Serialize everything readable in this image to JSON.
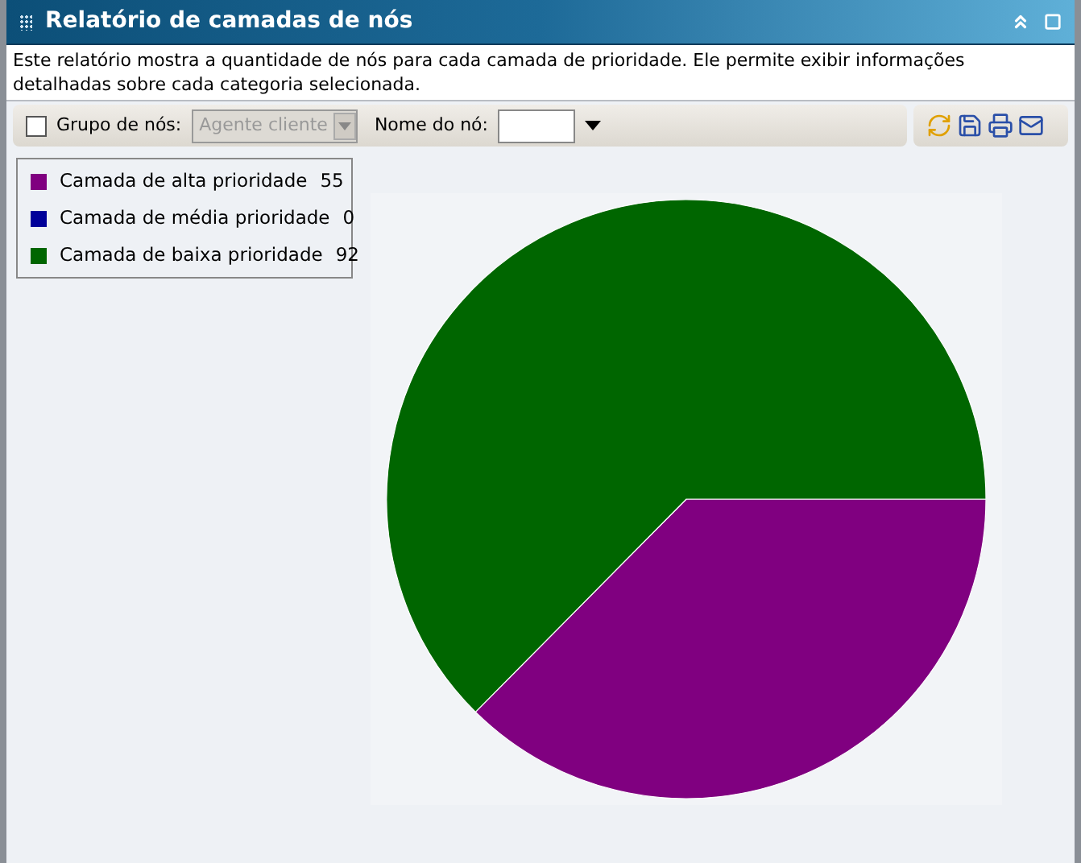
{
  "window": {
    "title": "Relatório de camadas de nós"
  },
  "description": "Este relatório mostra a quantidade de nós para cada camada de prioridade. Ele permite exibir informações detalhadas sobre cada categoria selecionada.",
  "toolbar": {
    "group_checkbox": {
      "label": "Grupo de nós:",
      "checked": false
    },
    "group_select": {
      "value": "Agente cliente",
      "disabled": true
    },
    "node_name": {
      "label": "Nome do nó:"
    }
  },
  "legend": [
    {
      "label": "Camada de alta prioridade",
      "count": "55",
      "color": "#800080"
    },
    {
      "label": "Camada de média prioridade",
      "count": "0",
      "color": "#000099"
    },
    {
      "label": "Camada de baixa prioridade",
      "count": "92",
      "color": "#006600"
    }
  ]
}
